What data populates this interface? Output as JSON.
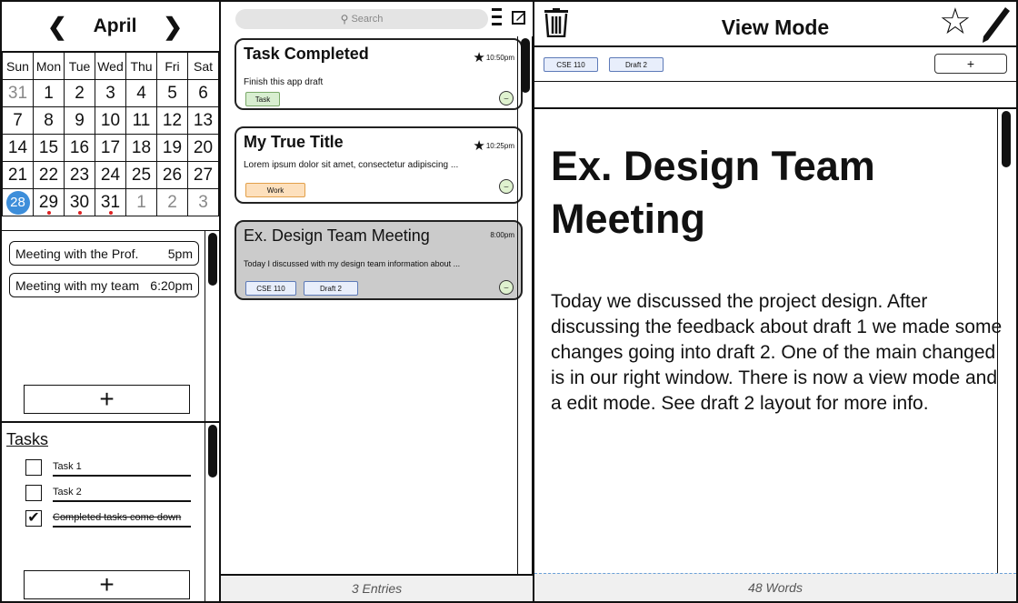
{
  "calendar": {
    "month": "April",
    "prev_icon": "chevron-left-icon",
    "next_icon": "chevron-right-icon",
    "weekdays": [
      "Sun",
      "Mon",
      "Tue",
      "Wed",
      "Thu",
      "Fri",
      "Sat"
    ],
    "weeks": [
      [
        "31",
        "1",
        "2",
        "3",
        "4",
        "5",
        "6"
      ],
      [
        "7",
        "8",
        "9",
        "10",
        "11",
        "12",
        "13"
      ],
      [
        "14",
        "15",
        "16",
        "17",
        "18",
        "19",
        "20"
      ],
      [
        "21",
        "22",
        "23",
        "24",
        "25",
        "26",
        "27"
      ],
      [
        "28",
        "29",
        "30",
        "31",
        "1",
        "2",
        "3"
      ]
    ],
    "today": "28"
  },
  "events": [
    {
      "title": "Meeting with the Prof.",
      "time": "5pm"
    },
    {
      "title": "Meeting with my team",
      "time": "6:20pm"
    }
  ],
  "add_event_label": "+",
  "tasks": {
    "title": "Tasks",
    "items": [
      {
        "label": "Task 1",
        "done": false
      },
      {
        "label": "Task 2",
        "done": false
      },
      {
        "label": "Completed tasks come down",
        "done": true
      }
    ],
    "add_label": "+"
  },
  "search": {
    "placeholder": "Search",
    "icon": "search-icon"
  },
  "entries": [
    {
      "title": "Task Completed",
      "time": "10:50pm",
      "starred": true,
      "body": "Finish this app draft",
      "tags": [
        "Task"
      ],
      "mood": "smiley-icon"
    },
    {
      "title": "My True Title",
      "time": "10:25pm",
      "starred": true,
      "body": "Lorem ipsum dolor sit amet, consectetur adipiscing ...",
      "tags": [
        "Work"
      ],
      "mood": "smiley-icon"
    },
    {
      "title": "Ex. Design Team Meeting",
      "time": "8:00pm",
      "starred": false,
      "body": "Today I discussed with my design team information about ...",
      "tags": [
        "CSE 110",
        "Draft 2"
      ],
      "mood": "smiley-icon"
    }
  ],
  "entries_count": "3 Entries",
  "viewer": {
    "mode_title": "View Mode",
    "tags": [
      "CSE 110",
      "Draft 2"
    ],
    "add_tag_label": "+",
    "doc_title": "Ex. Design Team Meeting",
    "doc_body": "Today we discussed the project design. After discussing the feedback about draft 1 we made some changes going into draft 2. One of the main changed is in our right window. There is now a view mode and a edit mode. See draft 2 layout for more info.",
    "word_count": "48 Words"
  },
  "colors": {
    "today_highlight": "#3d8eda",
    "event_dot": "#dd2222",
    "tag_task": "#d8eed0",
    "tag_work": "#fde0bd",
    "tag_course": "#e8eefb",
    "selected_card": "#cbcbcb"
  }
}
